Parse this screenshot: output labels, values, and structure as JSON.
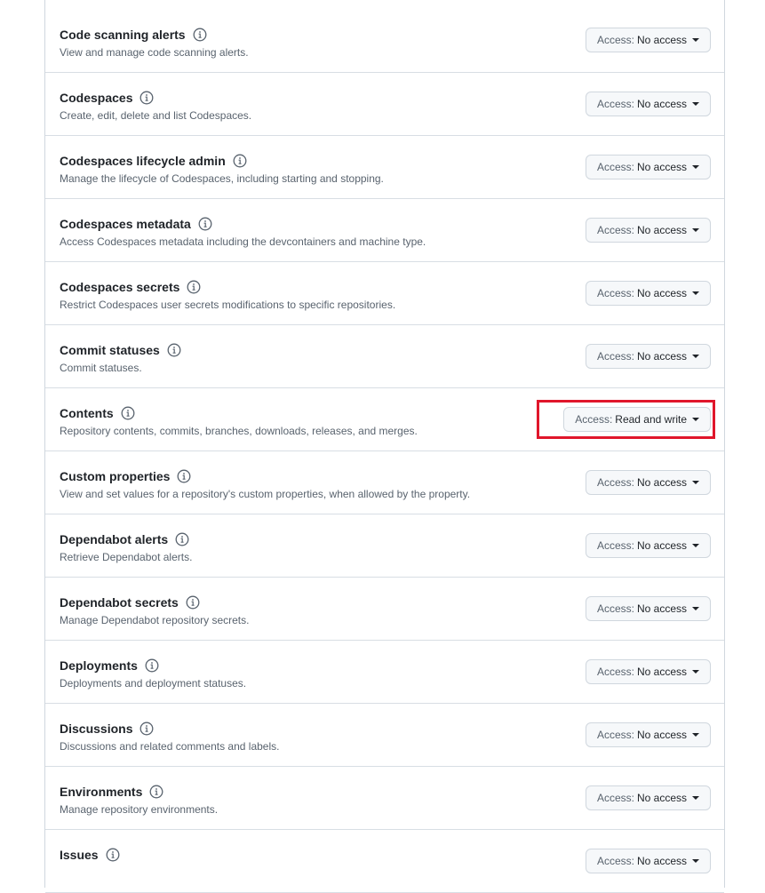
{
  "permissions": [
    {
      "title": "Code scanning alerts",
      "description": "View and manage code scanning alerts.",
      "access_prefix": "Access:",
      "access_value": "No access"
    },
    {
      "title": "Codespaces",
      "description": "Create, edit, delete and list Codespaces.",
      "access_prefix": "Access:",
      "access_value": "No access"
    },
    {
      "title": "Codespaces lifecycle admin",
      "description": "Manage the lifecycle of Codespaces, including starting and stopping.",
      "access_prefix": "Access:",
      "access_value": "No access"
    },
    {
      "title": "Codespaces metadata",
      "description": "Access Codespaces metadata including the devcontainers and machine type.",
      "access_prefix": "Access:",
      "access_value": "No access"
    },
    {
      "title": "Codespaces secrets",
      "description": "Restrict Codespaces user secrets modifications to specific repositories.",
      "access_prefix": "Access:",
      "access_value": "No access"
    },
    {
      "title": "Commit statuses",
      "description": "Commit statuses.",
      "access_prefix": "Access:",
      "access_value": "No access"
    },
    {
      "title": "Contents",
      "description": "Repository contents, commits, branches, downloads, releases, and merges.",
      "access_prefix": "Access:",
      "access_value": "Read and write"
    },
    {
      "title": "Custom properties",
      "description": "View and set values for a repository's custom properties, when allowed by the property.",
      "access_prefix": "Access:",
      "access_value": "No access"
    },
    {
      "title": "Dependabot alerts",
      "description": "Retrieve Dependabot alerts.",
      "access_prefix": "Access:",
      "access_value": "No access"
    },
    {
      "title": "Dependabot secrets",
      "description": "Manage Dependabot repository secrets.",
      "access_prefix": "Access:",
      "access_value": "No access"
    },
    {
      "title": "Deployments",
      "description": "Deployments and deployment statuses.",
      "access_prefix": "Access:",
      "access_value": "No access"
    },
    {
      "title": "Discussions",
      "description": "Discussions and related comments and labels.",
      "access_prefix": "Access:",
      "access_value": "No access"
    },
    {
      "title": "Environments",
      "description": "Manage repository environments.",
      "access_prefix": "Access:",
      "access_value": "No access"
    },
    {
      "title": "Issues",
      "description": "",
      "access_prefix": "Access:",
      "access_value": "No access"
    }
  ],
  "highlighted_index": 6,
  "colors": {
    "highlight": "#e0162b",
    "border": "#d0d7de",
    "button_bg": "#f6f8fa",
    "muted_text": "#59636e"
  }
}
